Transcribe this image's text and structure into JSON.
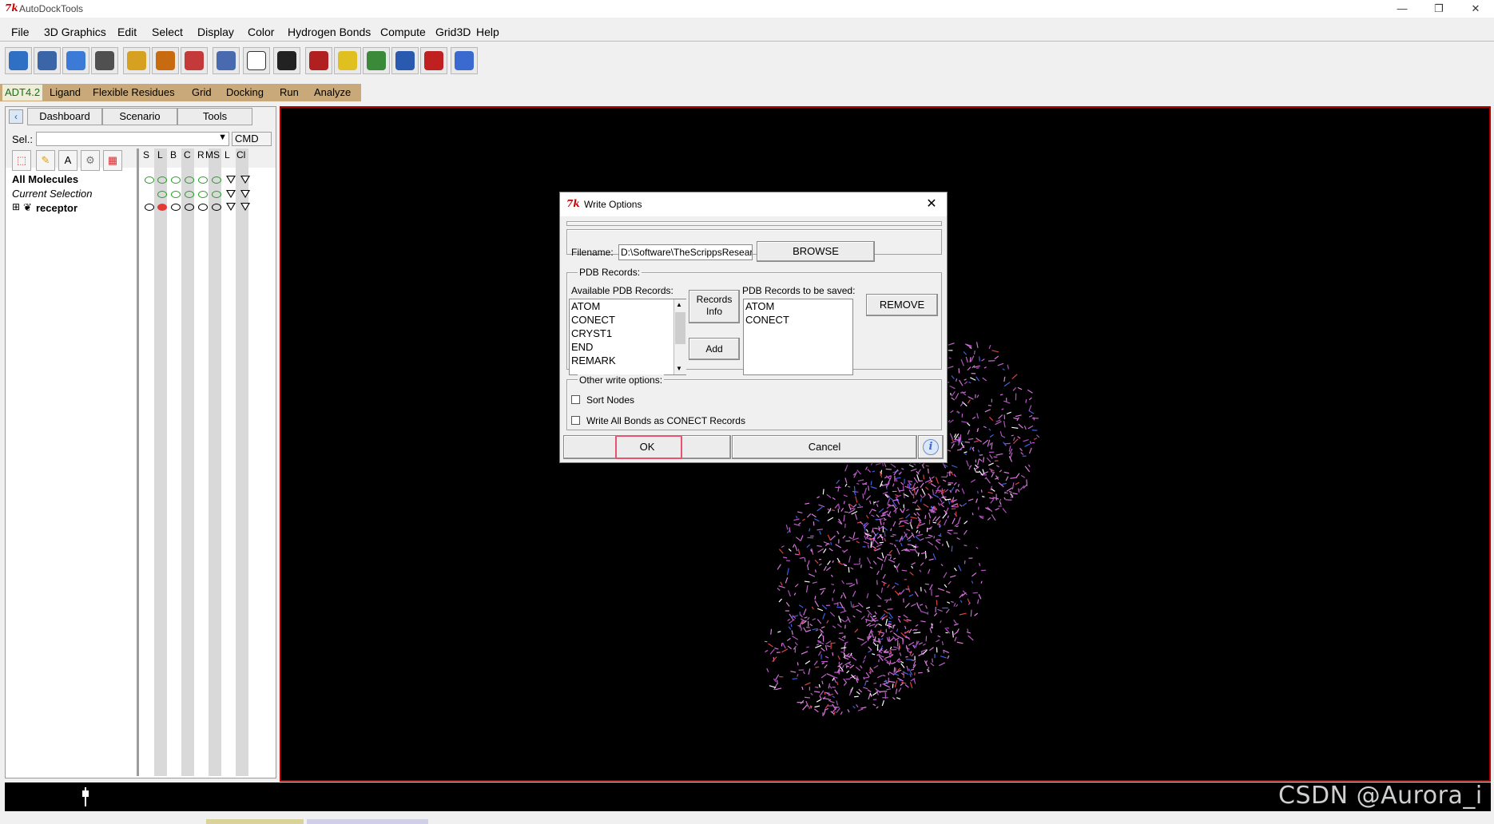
{
  "window": {
    "title": "AutoDockTools",
    "tk_logo": "7k",
    "controls": [
      "—",
      "❐",
      "✕"
    ]
  },
  "menu": [
    "File",
    "3D Graphics",
    "Edit",
    "Select",
    "Display",
    "Color",
    "Hydrogen Bonds",
    "Compute",
    "Grid3D",
    "Help"
  ],
  "toolbar_icons": [
    {
      "name": "open-icon",
      "color": "#2f6fc4"
    },
    {
      "name": "save-icon",
      "color": "#3a66a8"
    },
    {
      "name": "undo-icon",
      "color": "#3c7ad8"
    },
    {
      "name": "redo-icon",
      "color": "#505050"
    },
    {
      "name": "pencil-icon",
      "color": "#d6a020"
    },
    {
      "name": "crosshair-icon",
      "color": "#c86a10"
    },
    {
      "name": "select-icon",
      "color": "#c43a3a"
    },
    {
      "name": "pick-icon",
      "color": "#4a6ab0"
    },
    {
      "name": "python-shell-icon",
      "color": "#ffffff"
    },
    {
      "name": "text-align-icon",
      "color": "#222222"
    },
    {
      "name": "monitor-icon",
      "color": "#b02020"
    },
    {
      "name": "color-sphere-icon",
      "color": "#e0c020"
    },
    {
      "name": "hierarchy-icon",
      "color": "#3a8a3a"
    },
    {
      "name": "stereo-glasses-icon",
      "color": "#2a5ab0"
    },
    {
      "name": "dna-icon",
      "color": "#c02020"
    },
    {
      "name": "help-map-icon",
      "color": "#3a6ad0"
    }
  ],
  "adt_tabs": [
    "ADT4.2",
    "Ligand",
    "Flexible Residues",
    "Grid",
    "Docking",
    "Run",
    "Analyze"
  ],
  "dashboard": {
    "tabs": [
      "Dashboard",
      "Scenario",
      "Tools"
    ],
    "sel_label": "Sel.:",
    "cmd_label": "CMD",
    "columns": [
      "S",
      "L",
      "B",
      "C",
      "R",
      "MS",
      "L",
      "Cl"
    ],
    "tree": [
      {
        "label": "All Molecules"
      },
      {
        "label": "Current Selection"
      },
      {
        "label": "receptor"
      }
    ]
  },
  "dialog": {
    "title": "Write Options",
    "filename_label": "Filename:",
    "filename_value": "D:\\Software\\TheScrippsResearchInstitute",
    "browse_label": "BROWSE",
    "pdb_records_label": "PDB Records:",
    "available_label": "Available PDB Records:",
    "available_items": [
      "ATOM",
      "CONECT",
      "CRYST1",
      "END",
      "REMARK"
    ],
    "records_info_label_1": "Records",
    "records_info_label_2": "Info",
    "add_label": "Add",
    "tosave_label": "PDB Records to be saved:",
    "tosave_items": [
      "ATOM",
      "CONECT"
    ],
    "remove_label": "REMOVE",
    "other_options_label": "Other write options:",
    "sort_nodes_label": "Sort Nodes",
    "sort_nodes_checked": false,
    "write_bonds_label": "Write All Bonds as CONECT Records",
    "write_bonds_checked": false,
    "ok_label": "OK",
    "cancel_label": "Cancel",
    "info_icon": "i"
  },
  "watermark": "CSDN @Aurora_i",
  "colors": {
    "viewer_bg": "#000000",
    "viewer_border": "#b00000",
    "adt_bar": "#c9a97a",
    "ok_highlight": "#e8536e",
    "molecule": "#d070d8"
  }
}
